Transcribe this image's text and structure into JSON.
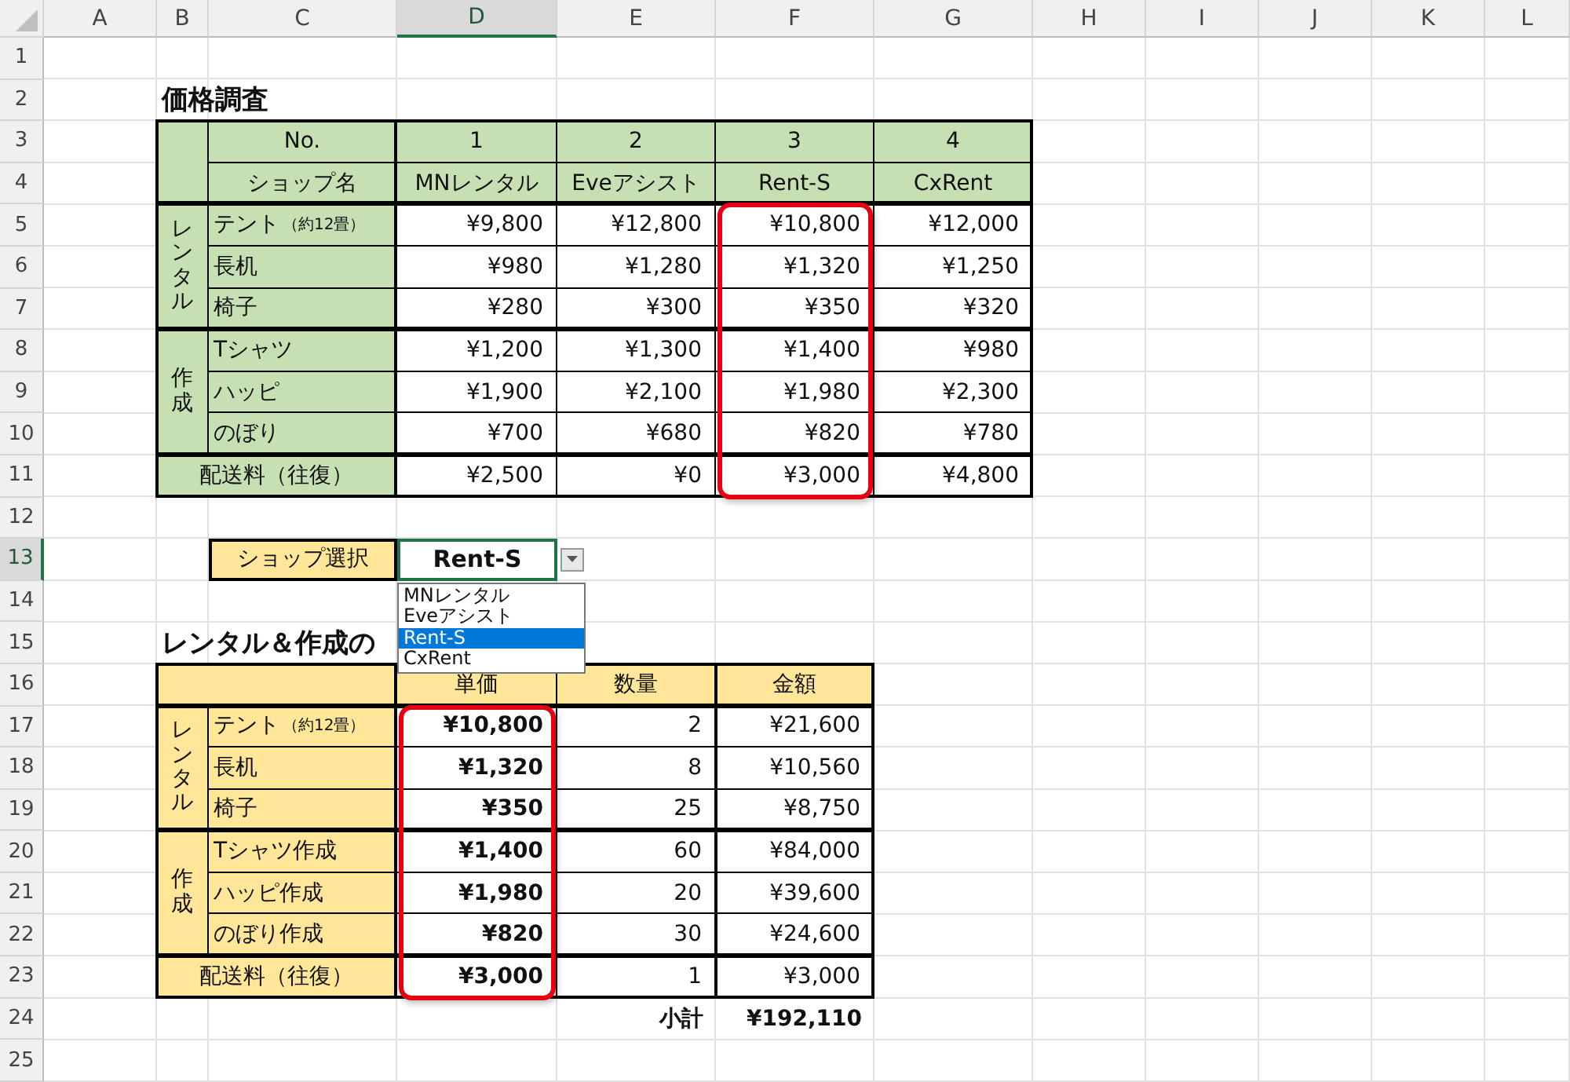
{
  "column_headers": [
    {
      "label": "A",
      "selected": false
    },
    {
      "label": "B",
      "selected": false
    },
    {
      "label": "C",
      "selected": false
    },
    {
      "label": "D",
      "selected": true
    },
    {
      "label": "E",
      "selected": false
    },
    {
      "label": "F",
      "selected": false
    },
    {
      "label": "G",
      "selected": false
    },
    {
      "label": "H",
      "selected": false
    },
    {
      "label": "I",
      "selected": false
    },
    {
      "label": "J",
      "selected": false
    },
    {
      "label": "K",
      "selected": false
    },
    {
      "label": "L",
      "selected": false
    }
  ],
  "row_headers": [
    {
      "label": "1",
      "selected": false
    },
    {
      "label": "2",
      "selected": false
    },
    {
      "label": "3",
      "selected": false
    },
    {
      "label": "4",
      "selected": false
    },
    {
      "label": "5",
      "selected": false
    },
    {
      "label": "6",
      "selected": false
    },
    {
      "label": "7",
      "selected": false
    },
    {
      "label": "8",
      "selected": false
    },
    {
      "label": "9",
      "selected": false
    },
    {
      "label": "10",
      "selected": false
    },
    {
      "label": "11",
      "selected": false
    },
    {
      "label": "12",
      "selected": false
    },
    {
      "label": "13",
      "selected": true
    },
    {
      "label": "14",
      "selected": false
    },
    {
      "label": "15",
      "selected": false
    },
    {
      "label": "16",
      "selected": false
    },
    {
      "label": "17",
      "selected": false
    },
    {
      "label": "18",
      "selected": false
    },
    {
      "label": "19",
      "selected": false
    },
    {
      "label": "20",
      "selected": false
    },
    {
      "label": "21",
      "selected": false
    },
    {
      "label": "22",
      "selected": false
    },
    {
      "label": "23",
      "selected": false
    },
    {
      "label": "24",
      "selected": false
    },
    {
      "label": "25",
      "selected": false
    }
  ],
  "price_survey": {
    "title": "価格調査",
    "no_label": "No.",
    "shop_label": "ショップ名",
    "shops": [
      {
        "no": "1",
        "name": "MNレンタル",
        "highlighted": false
      },
      {
        "no": "2",
        "name": "Eveアシスト",
        "highlighted": false
      },
      {
        "no": "3",
        "name": "Rent-S",
        "highlighted": true
      },
      {
        "no": "4",
        "name": "CxRent",
        "highlighted": false
      }
    ],
    "groups": [
      {
        "label": "レンタル",
        "items": [
          {
            "name": "テント",
            "note": "（約12畳）",
            "prices": [
              "¥9,800",
              "¥12,800",
              "¥10,800",
              "¥12,000"
            ]
          },
          {
            "name": "長机",
            "prices": [
              "¥980",
              "¥1,280",
              "¥1,320",
              "¥1,250"
            ]
          },
          {
            "name": "椅子",
            "prices": [
              "¥280",
              "¥300",
              "¥350",
              "¥320"
            ]
          }
        ]
      },
      {
        "label": "作成",
        "items": [
          {
            "name": "Tシャツ",
            "prices": [
              "¥1,200",
              "¥1,300",
              "¥1,400",
              "¥980"
            ]
          },
          {
            "name": "ハッピ",
            "prices": [
              "¥1,900",
              "¥2,100",
              "¥1,980",
              "¥2,300"
            ]
          },
          {
            "name": "のぼり",
            "prices": [
              "¥700",
              "¥680",
              "¥820",
              "¥780"
            ]
          }
        ]
      }
    ],
    "shipping": {
      "name": "配送料（往復）",
      "prices": [
        "¥2,500",
        "¥0",
        "¥3,000",
        "¥4,800"
      ]
    }
  },
  "shop_select": {
    "label": "ショップ選択",
    "value": "Rent-S",
    "options": [
      {
        "label": "MNレンタル",
        "selected": false
      },
      {
        "label": "Eveアシスト",
        "selected": false
      },
      {
        "label": "Rent-S",
        "selected": true
      },
      {
        "label": "CxRent",
        "selected": false
      }
    ]
  },
  "order": {
    "title": "レンタル＆作成の",
    "columns": [
      {
        "label": "単価",
        "highlighted": true
      },
      {
        "label": "数量",
        "highlighted": false
      },
      {
        "label": "金額",
        "highlighted": false
      }
    ],
    "groups": [
      {
        "label": "レンタル",
        "items": [
          {
            "name": "テント",
            "note": "（約12畳）",
            "values": [
              "¥10,800",
              "2",
              "¥21,600"
            ]
          },
          {
            "name": "長机",
            "values": [
              "¥1,320",
              "8",
              "¥10,560"
            ]
          },
          {
            "name": "椅子",
            "values": [
              "¥350",
              "25",
              "¥8,750"
            ]
          }
        ]
      },
      {
        "label": "作成",
        "items": [
          {
            "name": "Tシャツ作成",
            "values": [
              "¥1,400",
              "60",
              "¥84,000"
            ]
          },
          {
            "name": "ハッピ作成",
            "values": [
              "¥1,980",
              "20",
              "¥39,600"
            ]
          },
          {
            "name": "のぼり作成",
            "values": [
              "¥820",
              "30",
              "¥24,600"
            ]
          }
        ]
      }
    ],
    "shipping": {
      "name": "配送料（往復）",
      "values": [
        "¥3,000",
        "1",
        "¥3,000"
      ]
    },
    "subtotal": {
      "label": "小計",
      "value": "¥192,110"
    }
  }
}
